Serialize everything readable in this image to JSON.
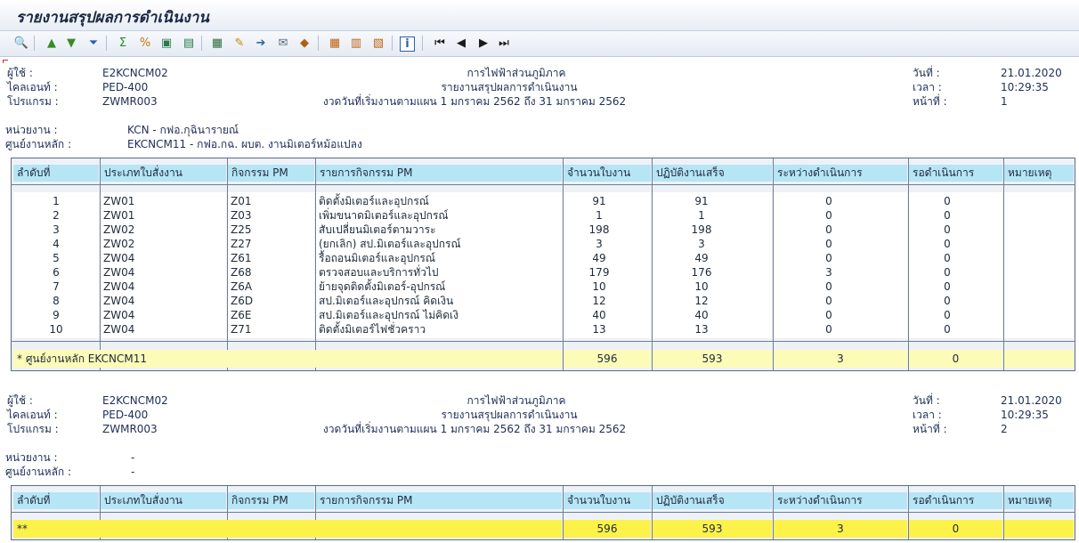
{
  "window": {
    "title": "รายงานสรุปผลการดำเนินงาน"
  },
  "toolbar": {
    "buttons": [
      {
        "name": "details-icon",
        "glyph": "🔍",
        "color": "#3a7d2c"
      },
      {
        "name": "sort-ascending-icon",
        "glyph": "▲",
        "color": "#3a8a2a"
      },
      {
        "name": "sort-descending-icon",
        "glyph": "▼",
        "color": "#3a8a2a"
      },
      {
        "name": "filter-icon",
        "glyph": "⏷",
        "color": "#2a5fb0"
      },
      {
        "name": "sum-icon",
        "glyph": "Σ",
        "color": "#2a8a2a"
      },
      {
        "name": "subtotal-icon",
        "glyph": "%",
        "color": "#c07a10"
      },
      {
        "name": "print-preview-icon",
        "glyph": "▣",
        "color": "#2a7a4a"
      },
      {
        "name": "print-icon",
        "glyph": "▤",
        "color": "#2a7a4a"
      },
      {
        "name": "export-spreadsheet-icon",
        "glyph": "▦",
        "color": "#2a6a3a"
      },
      {
        "name": "word-processing-icon",
        "glyph": "✎",
        "color": "#c08a10"
      },
      {
        "name": "local-file-icon",
        "glyph": "➔",
        "color": "#2a6a9a"
      },
      {
        "name": "mail-recipient-icon",
        "glyph": "✉",
        "color": "#5a6a7a"
      },
      {
        "name": "abc-analysis-icon",
        "glyph": "◆",
        "color": "#b06010"
      },
      {
        "name": "change-layout-icon",
        "glyph": "▦",
        "color": "#c06010"
      },
      {
        "name": "select-layout-icon",
        "glyph": "▥",
        "color": "#c06010"
      },
      {
        "name": "save-layout-icon",
        "glyph": "▧",
        "color": "#c06010"
      },
      {
        "name": "info-icon",
        "glyph": "i",
        "color": "#2a5fb0"
      },
      {
        "name": "first-page-icon",
        "glyph": "⏮",
        "color": "#1a1a1a"
      },
      {
        "name": "previous-page-icon",
        "glyph": "◀",
        "color": "#1a1a1a"
      },
      {
        "name": "next-page-icon",
        "glyph": "▶",
        "color": "#1a1a1a"
      },
      {
        "name": "last-page-icon",
        "glyph": "⏭",
        "color": "#1a1a1a"
      }
    ]
  },
  "page1": {
    "header": {
      "user_label": "ผู้ใช้     :",
      "user_value": "E2KCNCM02",
      "client_label": "ไคลเอนท์   :",
      "client_value": "PED-400",
      "program_label": "โปรแกรม    :",
      "program_value": "ZWMR003",
      "org_line": "การไฟฟ้าส่วนภูมิภาค",
      "report_line": "รายงานสรุปผลการดำเนินงาน",
      "period_line": "งวดวันที่เริ่มงานตามแผน 1 มกราคม 2562 ถึง 31 มกราคม 2562",
      "date_label": "วันที่     :",
      "date_value": "21.01.2020",
      "time_label": "เวลา       :",
      "time_value": "10:29:35",
      "page_label": "หน้าที่    :",
      "page_value": "1"
    },
    "unit_label": "หน่วยงาน      :",
    "unit_value": "KCN - กฟอ.กุฉินารายณ์",
    "center_label": "ศูนย์งานหลัก   :",
    "center_value": "EKCNCM11 - กฟอ.กฉ. ผบต. งานมิเตอร์หม้อแปลง",
    "rows": [
      {
        "no": "1",
        "type": "ZW01",
        "act": "Z01",
        "desc": "ติดตั้งมิเตอร์และอุปกรณ์",
        "count": "91",
        "done": "91",
        "inprog": "0",
        "wait": "0"
      },
      {
        "no": "2",
        "type": "ZW01",
        "act": "Z03",
        "desc": "เพิ่มขนาดมิเตอร์และอุปกรณ์",
        "count": "1",
        "done": "1",
        "inprog": "0",
        "wait": "0"
      },
      {
        "no": "3",
        "type": "ZW02",
        "act": "Z25",
        "desc": "สับเปลี่ยนมิเตอร์ตามวาระ",
        "count": "198",
        "done": "198",
        "inprog": "0",
        "wait": "0"
      },
      {
        "no": "4",
        "type": "ZW02",
        "act": "Z27",
        "desc": "(ยกเลิก) สป.มิเตอร์และอุปกรณ์",
        "count": "3",
        "done": "3",
        "inprog": "0",
        "wait": "0"
      },
      {
        "no": "5",
        "type": "ZW04",
        "act": "Z61",
        "desc": "รื้อถอนมิเตอร์และอุปกรณ์",
        "count": "49",
        "done": "49",
        "inprog": "0",
        "wait": "0"
      },
      {
        "no": "6",
        "type": "ZW04",
        "act": "Z68",
        "desc": "ตรวจสอบและบริการทั่วไป",
        "count": "179",
        "done": "176",
        "inprog": "3",
        "wait": "0"
      },
      {
        "no": "7",
        "type": "ZW04",
        "act": "Z6A",
        "desc": "ย้ายจุดติดตั้งมิเตอร์-อุปกรณ์",
        "count": "10",
        "done": "10",
        "inprog": "0",
        "wait": "0"
      },
      {
        "no": "8",
        "type": "ZW04",
        "act": "Z6D",
        "desc": "สป.มิเตอร์และอุปกรณ์ คิดเงิน",
        "count": "12",
        "done": "12",
        "inprog": "0",
        "wait": "0"
      },
      {
        "no": "9",
        "type": "ZW04",
        "act": "Z6E",
        "desc": "สป.มิเตอร์และอุปกรณ์ ไม่คิดเงิ",
        "count": "40",
        "done": "40",
        "inprog": "0",
        "wait": "0"
      },
      {
        "no": "10",
        "type": "ZW04",
        "act": "Z71",
        "desc": "ติดตั้งมิเตอร์ไฟชั่วคราว",
        "count": "13",
        "done": "13",
        "inprog": "0",
        "wait": "0"
      }
    ],
    "total": {
      "label": "*   ศูนย์งานหลัก EKCNCM11",
      "count": "596",
      "done": "593",
      "inprog": "3",
      "wait": "0"
    }
  },
  "columns": {
    "no": "ลำดับที่",
    "type": "ประเภทใบสั่งงาน",
    "act": "กิจกรรม PM",
    "desc": "รายการกิจกรรม PM",
    "count": "จำนวนใบงาน",
    "done": "ปฏิบัติงานเสร็จ",
    "inprog": "ระหว่างดำเนินการ",
    "wait": "รอดำเนินการ",
    "note": "หมายเหตุ"
  },
  "page2": {
    "header": {
      "user_label": "ผู้ใช้     :",
      "user_value": "E2KCNCM02",
      "client_label": "ไคลเอนท์   :",
      "client_value": "PED-400",
      "program_label": "โปรแกรม    :",
      "program_value": "ZWMR003",
      "org_line": "การไฟฟ้าส่วนภูมิภาค",
      "report_line": "รายงานสรุปผลการดำเนินงาน",
      "period_line": "งวดวันที่เริ่มงานตามแผน 1 มกราคม 2562 ถึง 31 มกราคม 2562",
      "date_label": "วันที่     :",
      "date_value": "21.01.2020",
      "time_label": "เวลา       :",
      "time_value": "10:29:35",
      "page_label": "หน้าที่    :",
      "page_value": "2"
    },
    "unit_label": "หน่วยงาน      :",
    "unit_value": "-",
    "center_label": "ศูนย์งานหลัก   :",
    "center_value": "-",
    "total": {
      "label": "**",
      "count": "596",
      "done": "593",
      "inprog": "3",
      "wait": "0"
    }
  }
}
